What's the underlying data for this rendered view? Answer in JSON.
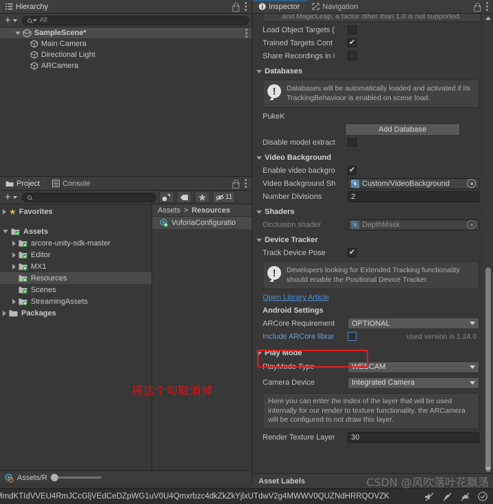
{
  "hierarchy": {
    "tab_label": "Hierarchy",
    "search_placeholder": "All",
    "scene_name": "SampleScene*",
    "objects": [
      "Main Camera",
      "Directional Light",
      "ARCamera"
    ]
  },
  "project": {
    "tabs": [
      "Project",
      "Console"
    ],
    "search_placeholder": "",
    "hidden_count": "11",
    "favorites_label": "Favorites",
    "tree": [
      {
        "label": "Assets",
        "depth": 0,
        "arrow": "open",
        "icon": "folder-script"
      },
      {
        "label": "arcore-unity-sdk-master",
        "depth": 1,
        "arrow": "closed",
        "icon": "folder-script"
      },
      {
        "label": "Editor",
        "depth": 1,
        "arrow": "closed",
        "icon": "folder-script"
      },
      {
        "label": "MX1",
        "depth": 1,
        "arrow": "closed",
        "icon": "folder-plus"
      },
      {
        "label": "Resources",
        "depth": 1,
        "arrow": "none",
        "icon": "folder-plus",
        "selected": true
      },
      {
        "label": "Scenes",
        "depth": 1,
        "arrow": "none",
        "icon": "folder-script"
      },
      {
        "label": "StreamingAssets",
        "depth": 1,
        "arrow": "closed",
        "icon": "folder-plus"
      },
      {
        "label": "Packages",
        "depth": 0,
        "arrow": "closed",
        "icon": "folder-plain"
      }
    ],
    "breadcrumb": [
      "Assets",
      "Resources"
    ],
    "asset_name": "VuforiaConfiguratio",
    "footer_path": "Assets/R"
  },
  "inspector": {
    "tabs": [
      "Inspector",
      "Navigation"
    ],
    "clipped_note": "and MagicLeap, a factor other than 1.0 is not supported.",
    "top_props": [
      {
        "label": "Load Object Targets (",
        "checked": false
      },
      {
        "label": "Trained Targets Cont",
        "checked": true
      },
      {
        "label": "Share Recordings in i",
        "checked": false
      }
    ],
    "databases": {
      "title": "Databases",
      "help": "Databases will be automatically loaded and activated if its TrackingBehaviour is enabled on scene load.",
      "entry": "PukeK",
      "add_button": "Add Database",
      "disable_label": "Disable model extract",
      "disable_checked": false
    },
    "video_background": {
      "title": "Video Background",
      "enable_label": "Enable video backgro",
      "enable_checked": true,
      "shader_label": "Video Background Sh",
      "shader_value": "Custom/VideoBackground",
      "divisions_label": "Number Divisions",
      "divisions_value": "2"
    },
    "shaders": {
      "title": "Shaders",
      "occlusion_label": "Occlusion shader",
      "occlusion_value": "DepthMask"
    },
    "device_tracker": {
      "title": "Device Tracker",
      "track_label": "Track Device Pose",
      "track_checked": true,
      "help": "Developers looking for Extended Tracking functionality should enable the Positional Device Tracker.",
      "link": "Open Library Article"
    },
    "android_settings": {
      "title": "Android Settings",
      "arcore_req_label": "ARCore Requirement",
      "arcore_req_value": "OPTIONAL",
      "include_label": "Include ARCore librar",
      "include_checked": false,
      "version_note": "used version is 1.24.0"
    },
    "play_mode": {
      "title": "Play Mode",
      "type_label": "PlayMode Type",
      "type_value": "WEBCAM",
      "device_label": "Camera Device",
      "device_value": "Integrated Camera",
      "help": "Here you can enter the index of the layer that will be used internally for our render to texture functionality. the ARCamera will be configured to not draw this layer.",
      "layer_label": "Render Texture Layer",
      "layer_value": "30"
    }
  },
  "asset_labels": {
    "title": "Asset Labels"
  },
  "annotation": {
    "text": "将这个勾取消掉",
    "color": "#d81414"
  },
  "status_bar": {
    "text": "MmdKTIdVVEU4RmJCcGljVEdCeDZpWG1uV0U4Qmxrbzc4dkZkZkYjlxUTdwV2g4MWWV0QUZNdHRRQOVZK"
  },
  "watermark": {
    "text": "CSDN @风吹落叶花飘荡"
  },
  "colors": {
    "accent_blue": "#2c5d87",
    "link_blue": "#4b8fd6",
    "annotation_red": "#e81b1b",
    "panel_bg": "#383838",
    "toolbar_bg": "#3c3c3c"
  }
}
